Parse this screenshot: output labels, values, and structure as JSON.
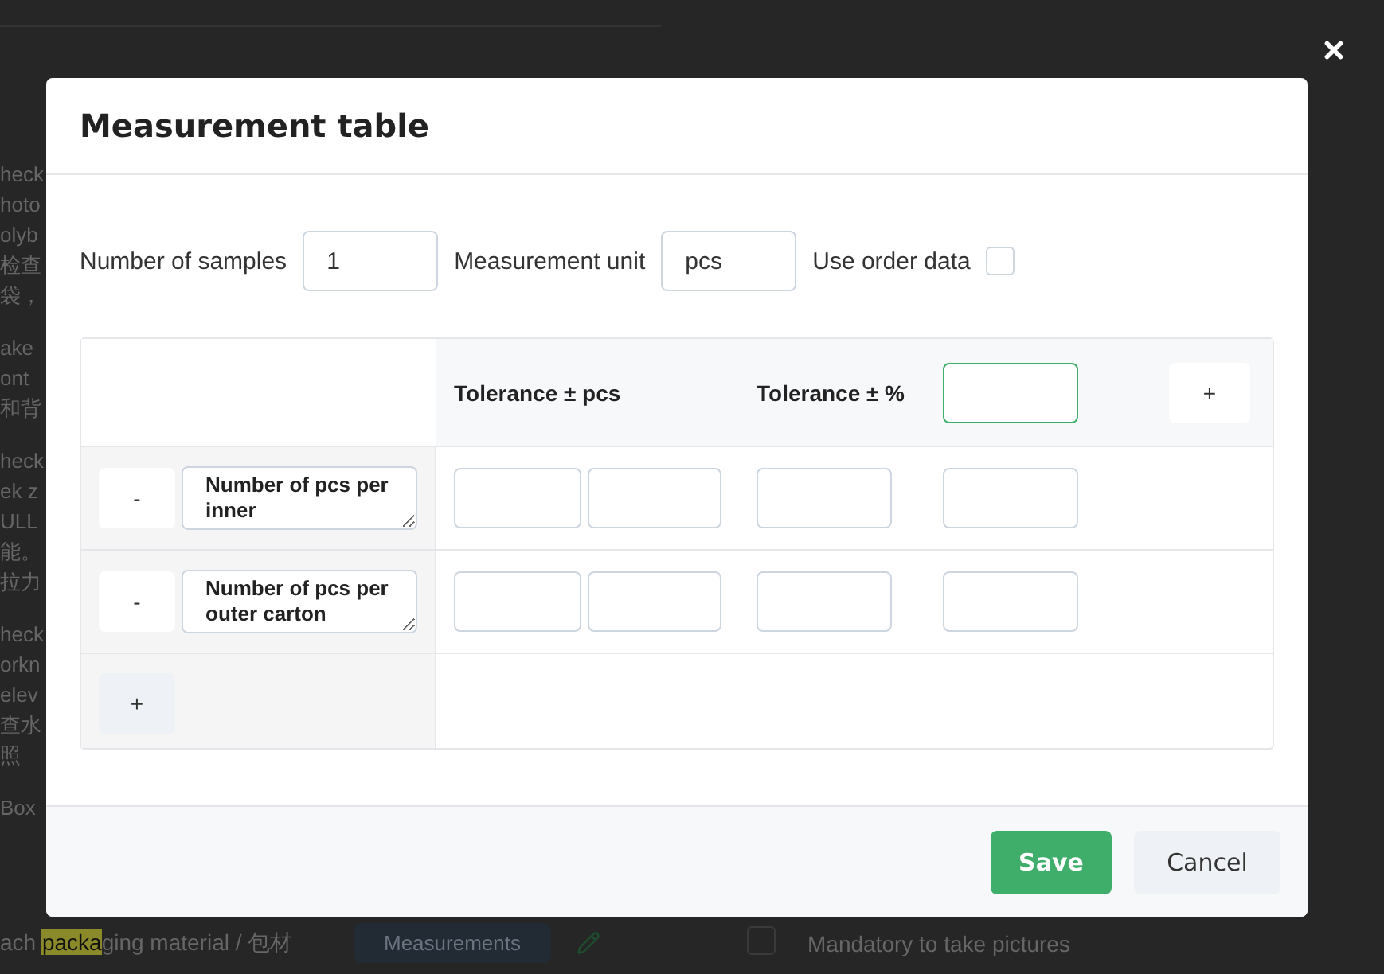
{
  "background": {
    "fragment_groups": [
      [
        {
          "text": "heck"
        },
        {
          "text": "hoto"
        },
        {
          "text": "olyb"
        },
        {
          "text": "检查"
        },
        {
          "text": "袋，"
        }
      ],
      [
        {
          "text": "ake"
        },
        {
          "text": "ont"
        },
        {
          "text": "和背"
        }
      ],
      [
        {
          "text": "heck"
        },
        {
          "text": "ek z"
        },
        {
          "text": "ULL"
        },
        {
          "text": "能。"
        },
        {
          "text": "拉力"
        }
      ],
      [
        {
          "text": "heck"
        },
        {
          "text": "orkn"
        },
        {
          "text": "elev"
        },
        {
          "text": "查水"
        },
        {
          "text": "照"
        }
      ],
      [
        {
          "text": "Box"
        }
      ]
    ],
    "packaging_text": "ach **packa**ging material / 包材",
    "measurements_button": "Measurements",
    "mandatory": {
      "label": "Mandatory to take pictures",
      "checked": false
    }
  },
  "dialog": {
    "title": "Measurement table",
    "fields": [
      {
        "label": "Number of samples",
        "value": "1"
      },
      {
        "label": "Measurement unit",
        "value": "pcs"
      }
    ],
    "use_order_data": {
      "label": "Use order data",
      "checked": false
    },
    "table": {
      "columns": [
        {
          "kind": "range",
          "label": "Tolerance ± pcs"
        },
        {
          "kind": "single",
          "label": "Tolerance ± %"
        },
        {
          "kind": "input",
          "focused": true
        }
      ],
      "add_column": "+",
      "rows": [
        {
          "name": "Number of pcs per inner",
          "remove": "-"
        },
        {
          "name": "Number of pcs per outer carton",
          "remove": "-"
        }
      ],
      "add_row": "+"
    },
    "buttons": [
      {
        "kind": "primary",
        "label": "Save"
      },
      {
        "kind": "secondary",
        "label": "Cancel"
      }
    ]
  }
}
